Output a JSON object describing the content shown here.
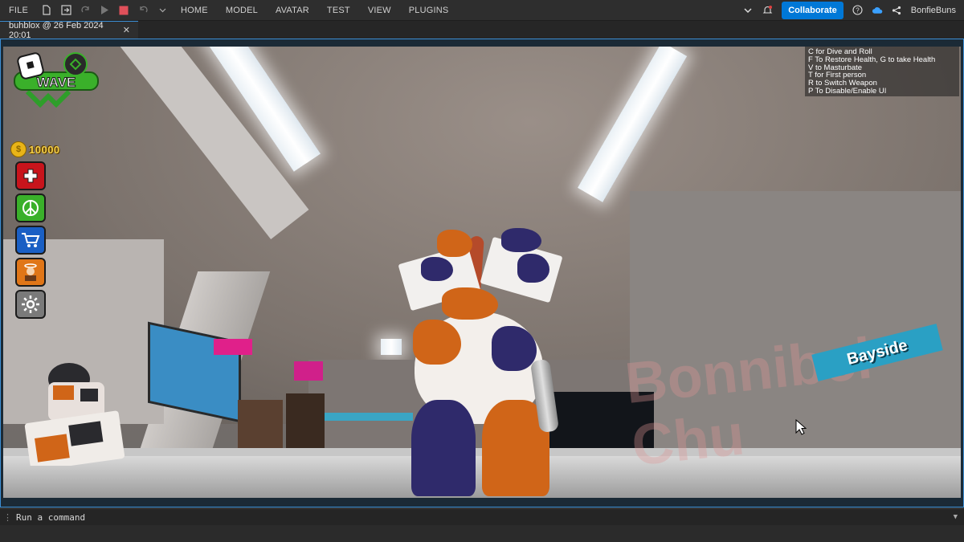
{
  "menu": {
    "file": "FILE",
    "tabs": [
      "HOME",
      "MODEL",
      "AVATAR",
      "TEST",
      "VIEW",
      "PLUGINS"
    ],
    "collaborate_label": "Collaborate",
    "username": "BonfieBuns"
  },
  "document_tab": {
    "title": "buhblox @ 26 Feb 2024 20:01",
    "close": "✕"
  },
  "hud": {
    "help_lines": [
      "C for Dive and Roll",
      "F To Restore Health, G to take Health",
      "V to Masturbate",
      "T for First person",
      "R to Switch Weapon",
      "P To Disable/Enable UI"
    ],
    "logo_text": "WAVE",
    "coins": "10000"
  },
  "scene": {
    "sign_text": "Bayside",
    "watermark_line1": "Bonnibel",
    "watermark_line2": "Chu"
  },
  "command_bar": {
    "placeholder": "Run a command"
  },
  "colors": {
    "accent": "#0078d7",
    "tab_border": "#3c8fd6"
  }
}
